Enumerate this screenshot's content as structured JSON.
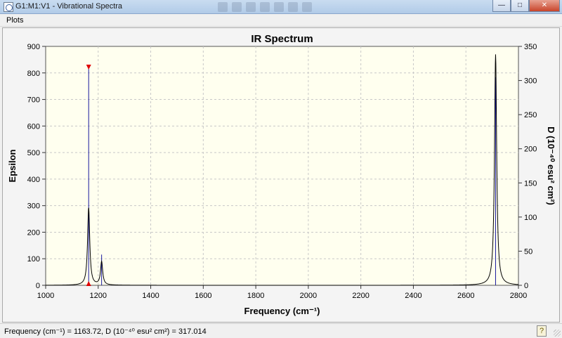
{
  "window": {
    "title": "G1:M1:V1 - Vibrational Spectra",
    "minimize": "—",
    "maximize": "□",
    "close": "✕"
  },
  "menu": {
    "items": [
      "Plots"
    ]
  },
  "chart_data": {
    "type": "line",
    "title": "IR Spectrum",
    "xlabel": "Frequency (cm⁻¹)",
    "ylabel_left": "Epsilon",
    "ylabel_right": "D (10⁻⁴⁰ esu² cm²)",
    "xlim": [
      1000,
      2800
    ],
    "ylim_left": [
      0,
      900
    ],
    "ylim_right": [
      0,
      350
    ],
    "x_ticks": [
      1000,
      1200,
      1400,
      1600,
      1800,
      2000,
      2200,
      2400,
      2600,
      2800
    ],
    "y_left_ticks": [
      0,
      100,
      200,
      300,
      400,
      500,
      600,
      700,
      800,
      900
    ],
    "y_right_ticks": [
      0,
      50,
      100,
      150,
      200,
      250,
      300,
      350
    ],
    "grid": true,
    "peaks": [
      {
        "frequency": 1163.72,
        "epsilon": 292,
        "intensity": 317.014
      },
      {
        "frequency": 1213,
        "epsilon": 88,
        "intensity": 45
      },
      {
        "frequency": 2713,
        "epsilon": 870,
        "intensity": 305
      }
    ],
    "selected_peak": {
      "frequency": 1163.72,
      "intensity": 317.014
    },
    "line_color": "#000000",
    "stick_color": "#1a1a9e",
    "marker_color": "#e00000",
    "plot_bg": "#ffffef"
  },
  "status": {
    "text": "Frequency (cm⁻¹) = 1163.72, D (10⁻⁴⁰ esu² cm²) = 317.014",
    "help": "?"
  }
}
